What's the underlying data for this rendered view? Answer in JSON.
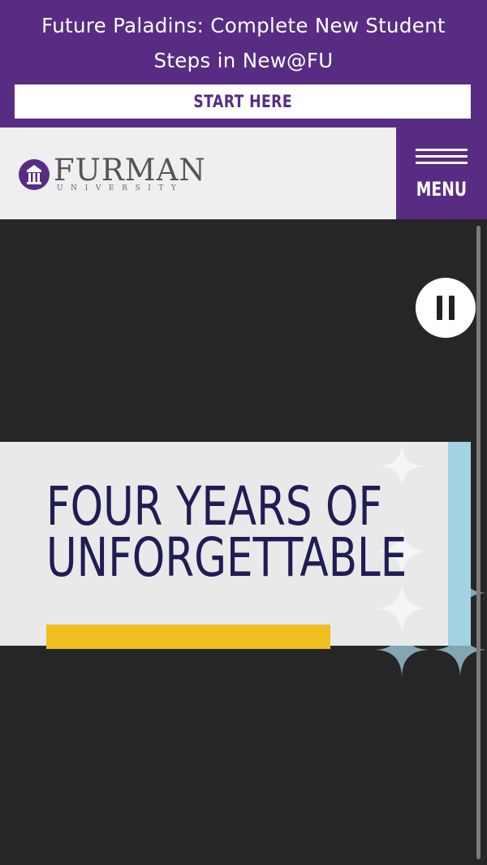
{
  "alert": {
    "message": "Future Paladins: Complete New Student Steps in New@FU",
    "button_label": "START HERE"
  },
  "header": {
    "logo_name": "FURMAN",
    "logo_subtitle": "UNIVERSITY",
    "menu_label": "MENU"
  },
  "hero": {
    "headline_line1": "FOUR YEARS OF",
    "headline_line2": "UNFORGETTABLE"
  },
  "colors": {
    "brand_purple": "#582c83",
    "hero_background": "#262626",
    "headline_navy": "#1f1d53",
    "accent_gold": "#f1be1f",
    "pattern_blue": "#a2d3e2"
  },
  "icons": {
    "menu": "hamburger-icon",
    "pause": "pause-icon",
    "logo": "bell-tower-seal"
  }
}
